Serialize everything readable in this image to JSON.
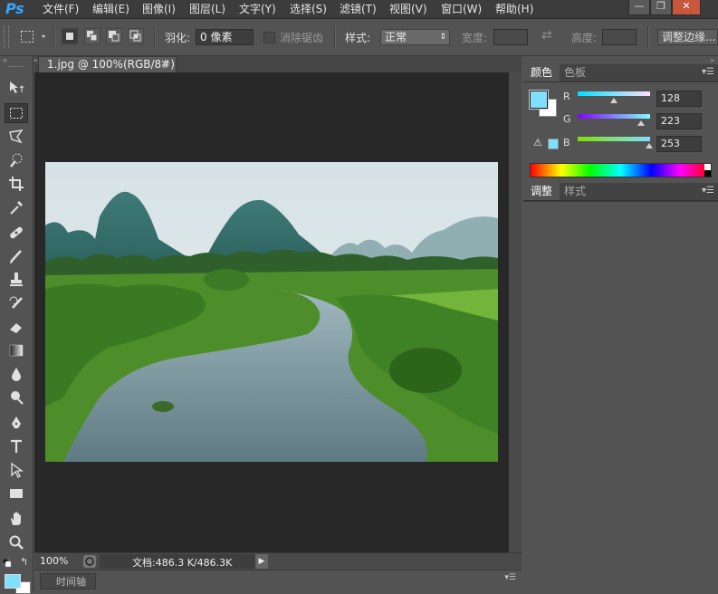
{
  "app": {
    "logo": "Ps"
  },
  "menu": [
    {
      "label": "文件(F)"
    },
    {
      "label": "编辑(E)"
    },
    {
      "label": "图像(I)"
    },
    {
      "label": "图层(L)"
    },
    {
      "label": "文字(Y)"
    },
    {
      "label": "选择(S)"
    },
    {
      "label": "滤镜(T)"
    },
    {
      "label": "视图(V)"
    },
    {
      "label": "窗口(W)"
    },
    {
      "label": "帮助(H)"
    }
  ],
  "window_controls": {
    "minimize": "—",
    "restore": "❐",
    "close": "✕"
  },
  "options": {
    "feather_label": "羽化:",
    "feather_value": "0 像素",
    "antialias_label": "消除锯齿",
    "style_label": "样式:",
    "style_value": "正常",
    "width_label": "宽度:",
    "height_label": "高度:",
    "refine_edge_label": "调整边缘..."
  },
  "document": {
    "tab_title": "1.jpg @ 100%(RGB/8#)",
    "tab_close": "×",
    "zoom": "100%",
    "doc_info": "文档:486.3 K/486.3K"
  },
  "timeline": {
    "label": "时间轴"
  },
  "color_panel": {
    "tabs": [
      "颜色",
      "色板"
    ],
    "r_label": "R",
    "g_label": "G",
    "b_label": "B",
    "r_value": "128",
    "g_value": "223",
    "b_value": "253",
    "r_level": 0.502,
    "g_level": 0.875,
    "b_level": 0.992,
    "foreground_color": "#80dffd",
    "background_color": "#ffffff"
  },
  "adjust_panel": {
    "tabs": [
      "调整",
      "样式"
    ]
  },
  "colors": {
    "app_bg": "#535353",
    "canvas_bg": "#282828",
    "accent": "#31a8ff"
  }
}
